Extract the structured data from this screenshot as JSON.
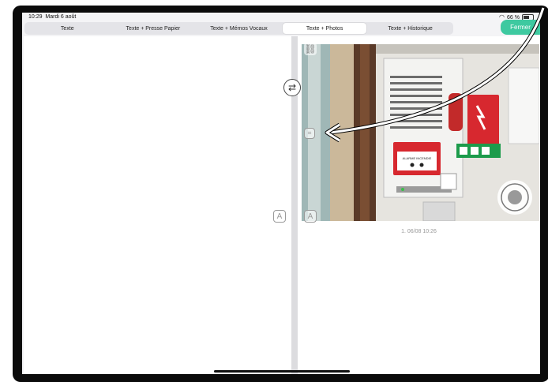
{
  "status_bar": {
    "time": "10:29",
    "date": "Mardi 6 août",
    "battery": "66 %"
  },
  "tabs": [
    {
      "label": "Texte",
      "active": false
    },
    {
      "label": "Texte + Presse Papier",
      "active": false
    },
    {
      "label": "Texte + Mémos Vocaux",
      "active": false
    },
    {
      "label": "Texte + Photos",
      "active": true
    },
    {
      "label": "Texte + Historique",
      "active": false
    }
  ],
  "close_button": {
    "label": "Fermer",
    "color": "#3ec9a0"
  },
  "photo": {
    "caption": "1.  06/08 10:26",
    "sign_text": "ALARME INCENDIE"
  },
  "icons": {
    "swap": "swap-arrows-icon",
    "link": "link-icon",
    "text_format": "text-format-icon",
    "camera_live_text": "live-text-icon",
    "annotation_arrow": "white-arrow-annotation"
  },
  "colors": {
    "accent": "#3ec9a0",
    "background": "#f4f4f6"
  }
}
